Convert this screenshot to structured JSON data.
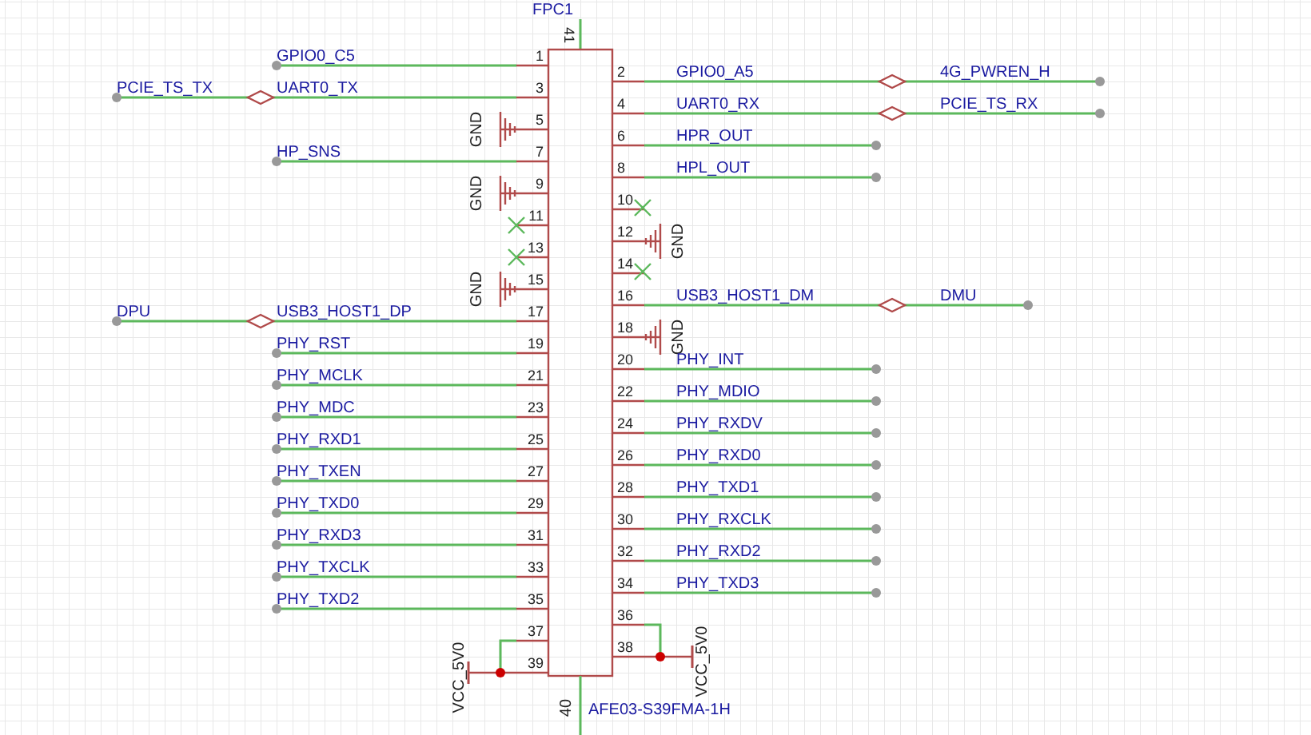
{
  "component": {
    "reference": "FPC1",
    "part_number": "AFE03-S39FMA-1H",
    "top_pin": {
      "number": "41"
    },
    "bottom_pin": {
      "number": "40"
    },
    "left_pins": [
      {
        "number": "1",
        "kind": "net",
        "net": "GPIO0_C5"
      },
      {
        "number": "3",
        "kind": "port",
        "net": "UART0_TX",
        "port": "PCIE_TS_TX"
      },
      {
        "number": "5",
        "kind": "gnd",
        "net": "GND"
      },
      {
        "number": "7",
        "kind": "net",
        "net": "HP_SNS"
      },
      {
        "number": "9",
        "kind": "gnd",
        "net": "GND"
      },
      {
        "number": "11",
        "kind": "nc"
      },
      {
        "number": "13",
        "kind": "nc"
      },
      {
        "number": "15",
        "kind": "gnd",
        "net": "GND"
      },
      {
        "number": "17",
        "kind": "port",
        "net": "USB3_HOST1_DP",
        "port": "DPU"
      },
      {
        "number": "19",
        "kind": "net",
        "net": "PHY_RST"
      },
      {
        "number": "21",
        "kind": "net",
        "net": "PHY_MCLK"
      },
      {
        "number": "23",
        "kind": "net",
        "net": "PHY_MDC"
      },
      {
        "number": "25",
        "kind": "net",
        "net": "PHY_RXD1"
      },
      {
        "number": "27",
        "kind": "net",
        "net": "PHY_TXEN"
      },
      {
        "number": "29",
        "kind": "net",
        "net": "PHY_TXD0"
      },
      {
        "number": "31",
        "kind": "net",
        "net": "PHY_RXD3"
      },
      {
        "number": "33",
        "kind": "net",
        "net": "PHY_TXCLK"
      },
      {
        "number": "35",
        "kind": "net",
        "net": "PHY_TXD2"
      },
      {
        "number": "37",
        "kind": "tie"
      },
      {
        "number": "39",
        "kind": "vcc",
        "net": "VCC_5V0"
      }
    ],
    "right_pins": [
      {
        "number": "2",
        "kind": "port",
        "net": "GPIO0_A5",
        "port": "4G_PWREN_H"
      },
      {
        "number": "4",
        "kind": "port",
        "net": "UART0_RX",
        "port": "PCIE_TS_RX"
      },
      {
        "number": "6",
        "kind": "net",
        "net": "HPR_OUT"
      },
      {
        "number": "8",
        "kind": "net",
        "net": "HPL_OUT"
      },
      {
        "number": "10",
        "kind": "nc"
      },
      {
        "number": "12",
        "kind": "gnd",
        "net": "GND"
      },
      {
        "number": "14",
        "kind": "nc"
      },
      {
        "number": "16",
        "kind": "port",
        "net": "USB3_HOST1_DM",
        "port": "DMU"
      },
      {
        "number": "18",
        "kind": "gnd",
        "net": "GND"
      },
      {
        "number": "20",
        "kind": "net",
        "net": "PHY_INT"
      },
      {
        "number": "22",
        "kind": "net",
        "net": "PHY_MDIO"
      },
      {
        "number": "24",
        "kind": "net",
        "net": "PHY_RXDV"
      },
      {
        "number": "26",
        "kind": "net",
        "net": "PHY_RXD0"
      },
      {
        "number": "28",
        "kind": "net",
        "net": "PHY_TXD1"
      },
      {
        "number": "30",
        "kind": "net",
        "net": "PHY_RXCLK"
      },
      {
        "number": "32",
        "kind": "net",
        "net": "PHY_RXD2"
      },
      {
        "number": "34",
        "kind": "net",
        "net": "PHY_TXD3"
      },
      {
        "number": "36",
        "kind": "tie"
      },
      {
        "number": "38",
        "kind": "vcc",
        "net": "VCC_5V0"
      }
    ]
  }
}
